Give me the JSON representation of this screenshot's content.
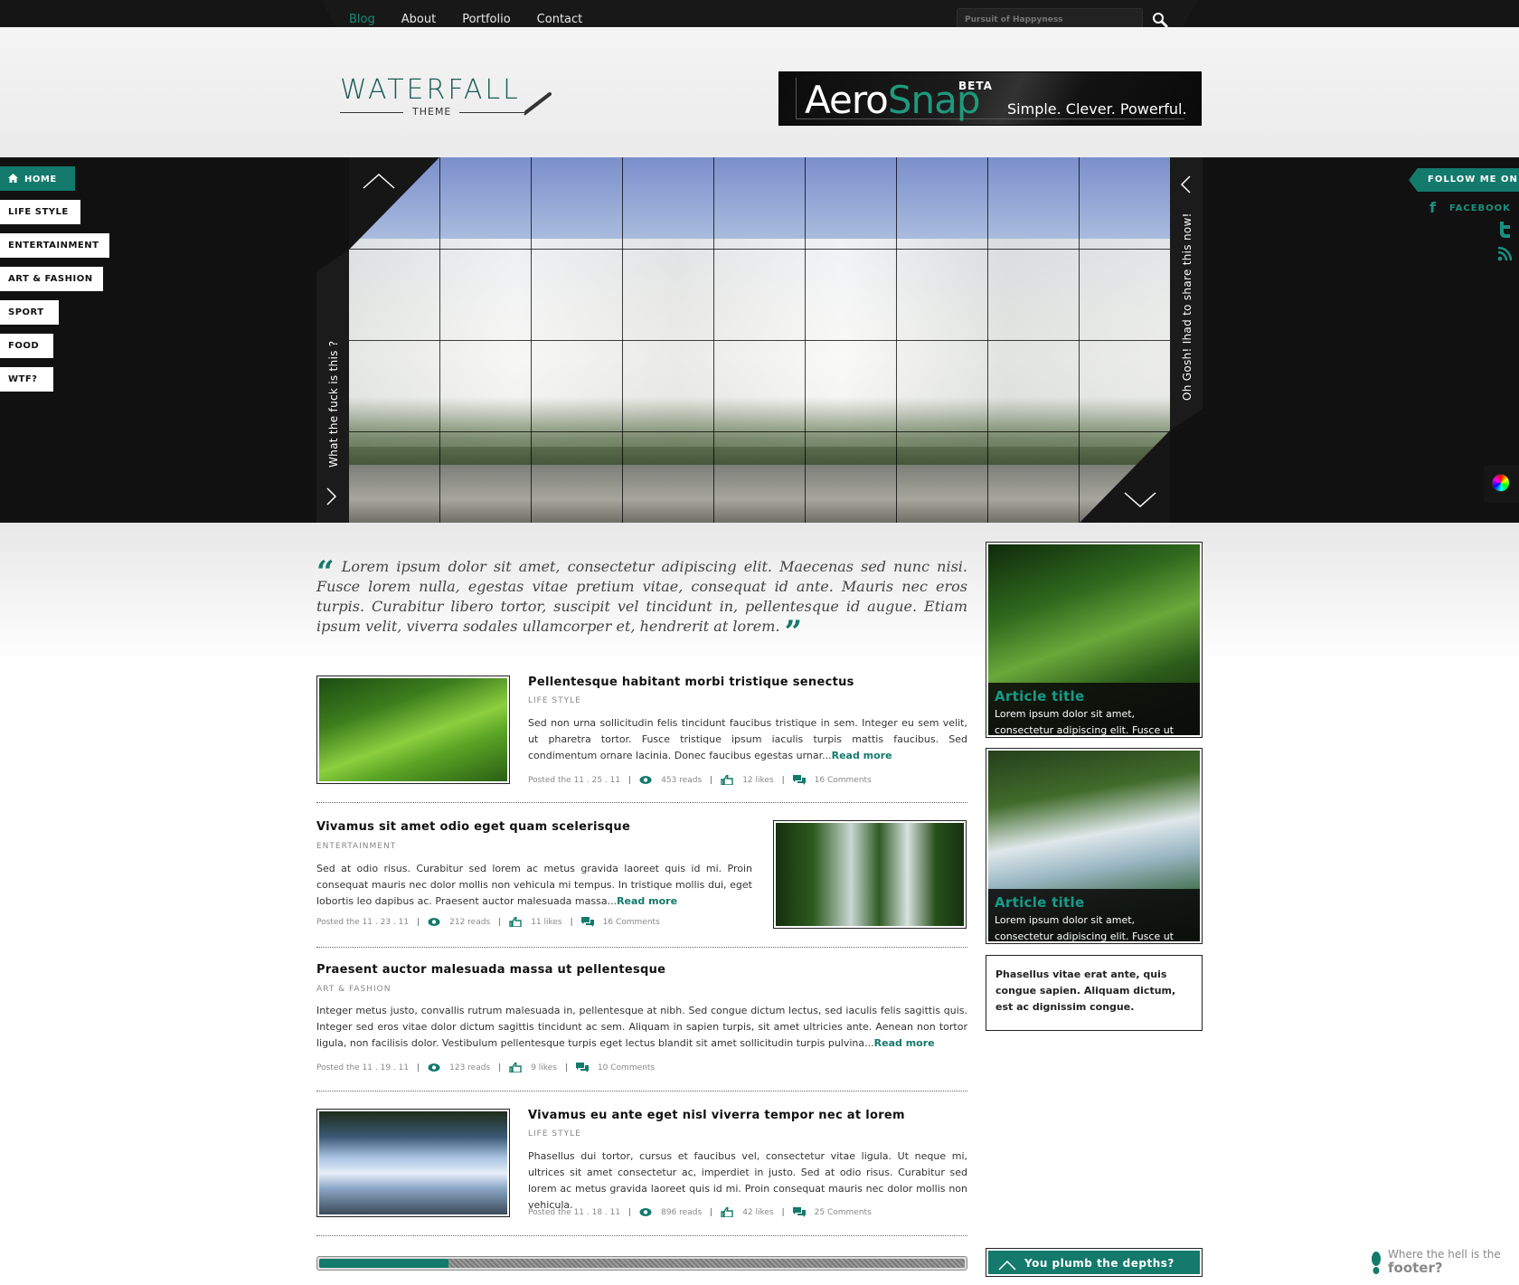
{
  "nav": {
    "items": [
      "Blog",
      "About",
      "Portfolio",
      "Contact"
    ],
    "active": "Blog",
    "search_placeholder": "Pursuit of Happyness"
  },
  "logo": {
    "title": "WATERFALL",
    "subtitle": "THEME"
  },
  "ad": {
    "brand_a": "Aero",
    "brand_b": "Snap",
    "beta": "BETA",
    "tagline": "Simple. Clever. Powerful."
  },
  "side_menu": [
    "HOME",
    "LIFE STYLE",
    "ENTERTAINMENT",
    "ART & FASHION",
    "SPORT",
    "FOOD",
    "WTF?"
  ],
  "slider": {
    "left_caption": "What  the fuck is this ?",
    "right_caption": "Oh Gosh! Ihad to share this now!"
  },
  "social": {
    "follow": "FOLLOW ME ON",
    "facebook": "FACEBOOK"
  },
  "quote": "Lorem ipsum dolor sit amet, consectetur adipiscing elit. Maecenas sed nunc nisi. Fusce lorem nulla, egestas vitae pretium vitae, consequat id ante. Mauris nec eros turpis. Curabitur libero tortor, suscipit vel tincidunt in, pellentesque id augue. Etiam ipsum velit, viverra sodales ullamcorper et, hendrerit at lorem.",
  "posts": [
    {
      "title": "Pellentesque habitant morbi tristique senectus",
      "category": "LIFE STYLE",
      "body": "Sed non urna sollicitudin felis tincidunt faucibus tristique in sem. Integer eu sem velit, ut pharetra tortor. Fusce tristique ipsum iaculis turpis mattis faucibus. Sed condimentum ornare lacinia. Donec faucibus egestas urnar...",
      "read_more": "Read more",
      "date": "Posted the 11 . 25 . 11",
      "reads": "453 reads",
      "likes": "12 likes",
      "comments": "16 Comments"
    },
    {
      "title": "Vivamus sit amet odio eget quam scelerisque",
      "category": "ENTERTAINMENT",
      "body": "Sed at odio risus. Curabitur sed lorem ac metus gravida laoreet quis id mi. Proin consequat mauris nec dolor mollis non vehicula mi tempus. In tristique mollis dui, eget lobortis leo dapibus ac. Praesent auctor malesuada massa...",
      "read_more": "Read more",
      "date": "Posted the 11 . 23 . 11",
      "reads": "212 reads",
      "likes": "11 likes",
      "comments": "16 Comments"
    },
    {
      "title": "Praesent auctor malesuada massa ut pellentesque",
      "category": "ART & FASHION",
      "body": "Integer metus justo, convallis rutrum malesuada in, pellentesque at nibh. Sed congue dictum lectus, sed iaculis felis sagittis quis. Integer sed eros vitae dolor dictum sagittis tincidunt ac sem. Aliquam in sapien turpis, sit amet ultricies ante. Aenean non tortor ligula, non facilisis dolor. Vestibulum pellentesque turpis eget lectus blandit sit amet sollicitudin turpis pulvina...",
      "read_more": "Read more",
      "date": "Posted the 11 . 19 . 11",
      "reads": "123 reads",
      "likes": "9 likes",
      "comments": "10 Comments"
    },
    {
      "title": "Vivamus eu ante eget nisl viverra tempor nec at lorem",
      "category": "LIFE STYLE",
      "body": "Phasellus dui tortor, cursus et faucibus vel, consectetur vitae ligula. Ut neque mi, ultrices sit amet consectetur ac, imperdiet in justo. Sed at odio risus. Curabitur sed lorem ac metus gravida laoreet quis id mi. Proin consequat mauris nec dolor mollis non vehicula.",
      "date": "Posted the 11 . 18 . 11",
      "reads": "896 reads",
      "likes": "42 likes",
      "comments": "25 Comments"
    }
  ],
  "pagination_progress": 0.2,
  "sidebar": {
    "cards": [
      {
        "title": "Article title",
        "text": "Lorem ipsum dolor sit amet, consectetur adipiscing elit. Fusce ut massa enim."
      },
      {
        "title": "Article title",
        "text": "Lorem ipsum dolor sit amet, consectetur adipiscing elit. Fusce ut massa enim."
      }
    ],
    "text_card": "Phasellus vitae erat ante, quis congue sapien. Aliquam dictum, est ac dignissim congue.",
    "depths_button": "You plumb the depths?"
  },
  "footer": {
    "line1": "Where the hell is the",
    "line2": "footer?"
  },
  "colors": {
    "accent": "#137a6c",
    "dark": "#111111"
  }
}
